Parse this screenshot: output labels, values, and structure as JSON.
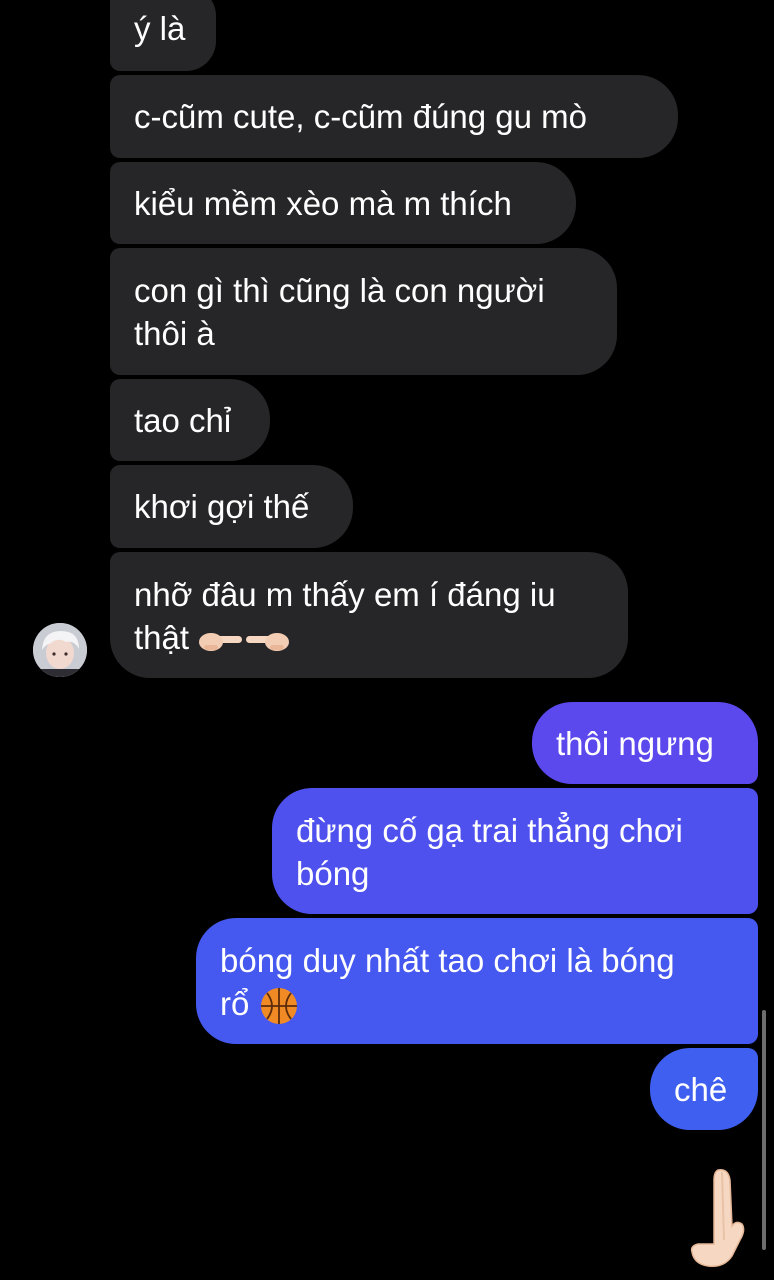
{
  "messages": {
    "incoming": [
      {
        "text": "ý là"
      },
      {
        "text": "c-cũm cute, c-cũm đúng gu mò"
      },
      {
        "text": "kiểu mềm xèo mà m thích"
      },
      {
        "line1": "con gì thì cũng là con người",
        "line2": "thôi à"
      },
      {
        "text": "tao chỉ"
      },
      {
        "text": "khơi gợi thế"
      },
      {
        "line1": "nhỡ đâu m thấy em í đáng iu",
        "line2": "thật",
        "emoji": "pointing-fingers"
      }
    ],
    "outgoing": [
      {
        "text": "thôi ngưng"
      },
      {
        "line1": "đừng cố gạ trai thẳng chơi",
        "line2": "bóng"
      },
      {
        "line1": "bóng duy nhất tao chơi là bóng",
        "line2": "rổ",
        "emoji": "basketball"
      },
      {
        "text": "chê"
      }
    ]
  },
  "reaction": {
    "emoji": "raised-back-of-hand"
  },
  "colors": {
    "background": "#000000",
    "incoming_bubble": "#262628",
    "outgoing_top": "#5a4cf0",
    "outgoing_bottom": "#3f5ff0",
    "text": "#ffffff"
  }
}
